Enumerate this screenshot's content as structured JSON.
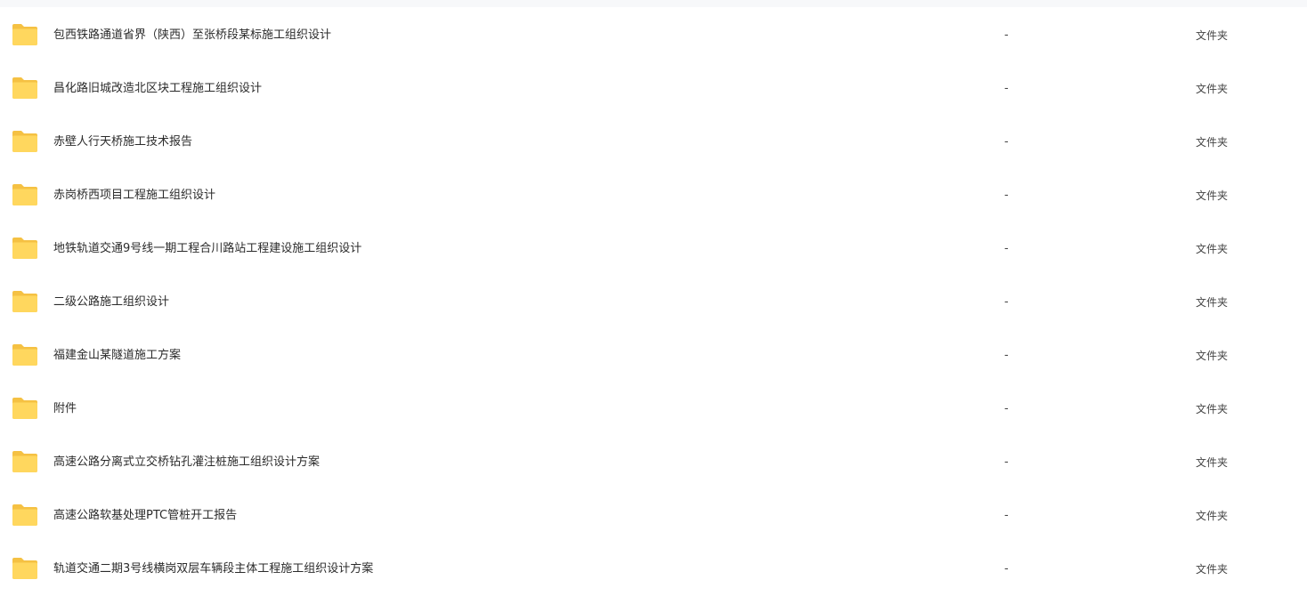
{
  "files": [
    {
      "name": "包西铁路通道省界（陕西）至张桥段某标施工组织设计",
      "size": "-",
      "type": "文件夹",
      "icon": "folder-icon"
    },
    {
      "name": "昌化路旧城改造北区块工程施工组织设计",
      "size": "-",
      "type": "文件夹",
      "icon": "folder-icon"
    },
    {
      "name": "赤壁人行天桥施工技术报告",
      "size": "-",
      "type": "文件夹",
      "icon": "folder-icon"
    },
    {
      "name": "赤岗桥西项目工程施工组织设计",
      "size": "-",
      "type": "文件夹",
      "icon": "folder-icon"
    },
    {
      "name": "地铁轨道交通9号线一期工程合川路站工程建设施工组织设计",
      "size": "-",
      "type": "文件夹",
      "icon": "folder-icon"
    },
    {
      "name": "二级公路施工组织设计",
      "size": "-",
      "type": "文件夹",
      "icon": "folder-icon"
    },
    {
      "name": "福建金山某隧道施工方案",
      "size": "-",
      "type": "文件夹",
      "icon": "folder-icon"
    },
    {
      "name": "附件",
      "size": "-",
      "type": "文件夹",
      "icon": "folder-icon"
    },
    {
      "name": "高速公路分离式立交桥钻孔灌注桩施工组织设计方案",
      "size": "-",
      "type": "文件夹",
      "icon": "folder-icon"
    },
    {
      "name": "高速公路软基处理PTC管桩开工报告",
      "size": "-",
      "type": "文件夹",
      "icon": "folder-icon"
    },
    {
      "name": "轨道交通二期3号线横岗双层车辆段主体工程施工组织设计方案",
      "size": "-",
      "type": "文件夹",
      "icon": "folder-icon"
    }
  ],
  "colors": {
    "folder_back": "#f5c143",
    "folder_front": "#ffd75e",
    "header_bg": "#f7f8fa"
  }
}
